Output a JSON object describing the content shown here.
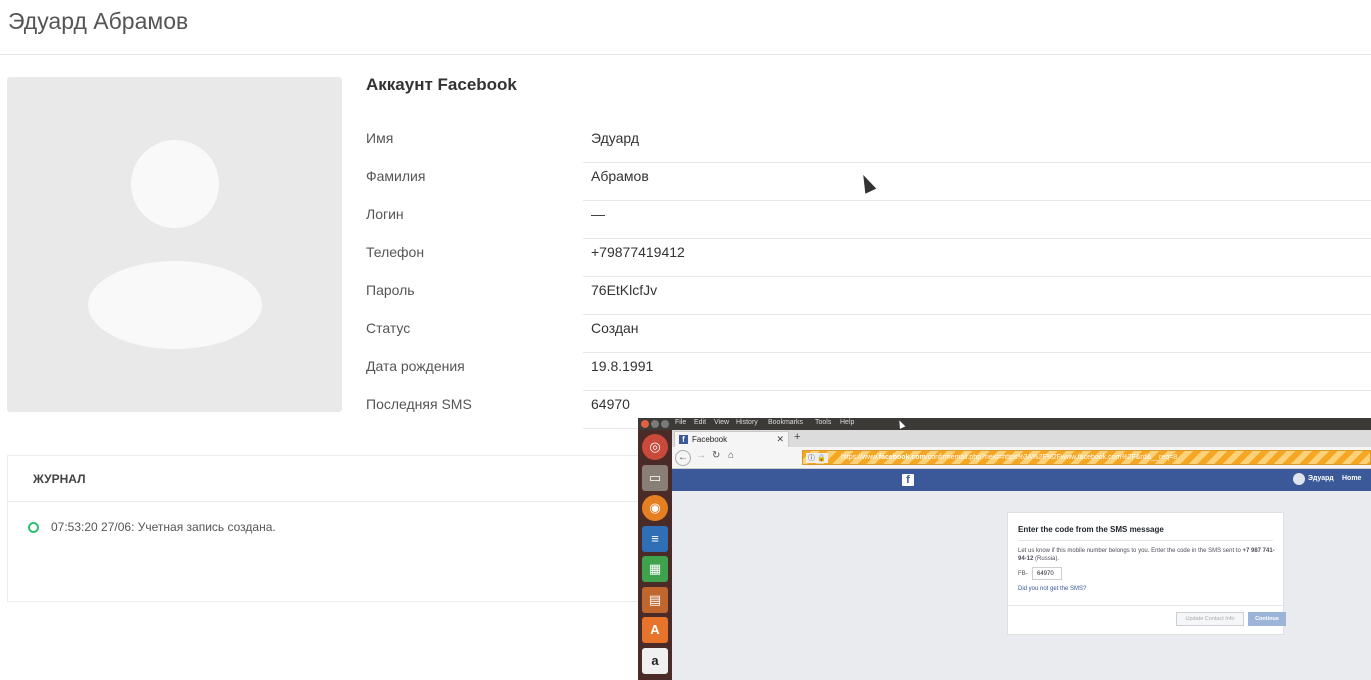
{
  "header": {
    "title": "Эдуард Абрамов"
  },
  "account": {
    "section_title": "Аккаунт Facebook",
    "rows": [
      {
        "label": "Имя",
        "value": "Эдуард"
      },
      {
        "label": "Фамилия",
        "value": "Абрамов"
      },
      {
        "label": "Логин",
        "value": "—"
      },
      {
        "label": "Телефон",
        "value": "+79877419412"
      },
      {
        "label": "Пароль",
        "value": "76EtKlcfJv"
      },
      {
        "label": "Статус",
        "value": "Создан"
      },
      {
        "label": "Дата рождения",
        "value": "19.8.1991"
      },
      {
        "label": "Последняя SMS",
        "value": "64970"
      }
    ]
  },
  "journal": {
    "title": "ЖУРНАЛ",
    "entries": [
      {
        "text": "07:53:20 27/06: Учетная запись создана.",
        "status_color": "#2fbf71"
      }
    ]
  },
  "overlay": {
    "menu": [
      "File",
      "Edit",
      "View",
      "History",
      "Bookmarks",
      "Tools",
      "Help"
    ],
    "launcher_icons": [
      "ubuntu-icon",
      "files-icon",
      "firefox-icon",
      "writer-icon",
      "calc-icon",
      "impress-icon",
      "software-center-icon",
      "amazon-icon"
    ],
    "tab_title": "Facebook",
    "url": {
      "prefix": "https://www.",
      "domain": "facebook.com",
      "rest": "/confirmemail.php?next=https%3A%2F%2Fwww.facebook.com%2F&rd&__req=8"
    },
    "fb_user": "Эдуард",
    "fb_home": "Home",
    "sms": {
      "title": "Enter the code from the SMS message",
      "text_before": "Let us know if this mobile number belongs to you. Enter the code in the SMS sent to ",
      "phone": "+7 987 741-94-12",
      "text_after": " (Russia).",
      "code_label": "FB-",
      "code_value": "64970",
      "link": "Did you not get the SMS?",
      "update_button": "Update Contact Info",
      "continue_button": "Continue"
    }
  }
}
